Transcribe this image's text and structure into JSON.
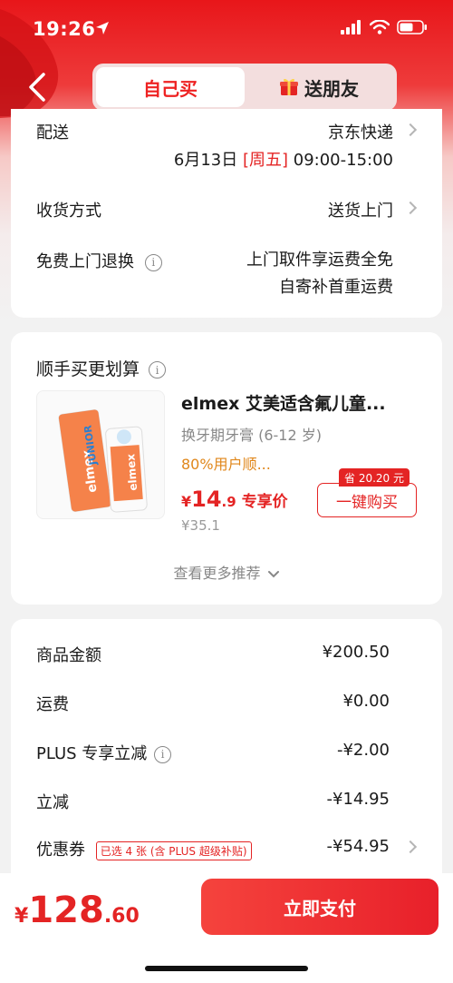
{
  "status_bar": {
    "time": "19:26"
  },
  "nav": {
    "tab_self": "自己买",
    "tab_gift": "送朋友"
  },
  "delivery": {
    "shipping_label": "配送",
    "shipping_value": "京东快递",
    "date": "6月13日",
    "weekday": "[周五]",
    "time_range": "09:00-15:00",
    "receive_label": "收货方式",
    "receive_value": "送货上门",
    "return_label": "免费上门退换",
    "return_line1": "上门取件享运费全免",
    "return_line2": "自寄补首重运费"
  },
  "recommend": {
    "title": "顺手买更划算",
    "product_title": "elmex 艾美适含氟儿童...",
    "product_sub": "换牙期牙膏 (6-12 岁)",
    "product_tag": "80%用户顺...",
    "price_currency": "¥",
    "price_int": "14",
    "price_dec": ".9",
    "price_label": "专享价",
    "original_price": "¥35.1",
    "save_badge": "省 20.20 元",
    "buy_button": "一键购买",
    "more_link": "查看更多推荐"
  },
  "summary": {
    "rows": [
      {
        "label": "商品金额",
        "value": "¥200.50",
        "red": false
      },
      {
        "label": "运费",
        "value": "¥0.00",
        "red": false
      },
      {
        "label": "PLUS 专享立减",
        "value": "-¥2.00",
        "red": true
      },
      {
        "label": "立减",
        "value": "-¥14.95",
        "red": true
      },
      {
        "label": "优惠券",
        "value": "-¥54.95",
        "red": true
      }
    ],
    "coupon_tag": "已选 4 张 (含 PLUS 超级补贴)"
  },
  "bottom": {
    "currency": "¥",
    "total_int": "128",
    "total_dec": ".60",
    "pay_button": "立即支付"
  },
  "colors": {
    "brand_red": "#e42424",
    "tag_orange": "#e0871b"
  },
  "icons": [
    "location-arrow-icon",
    "signal-icon",
    "wifi-icon",
    "battery-icon",
    "back-icon",
    "gift-icon",
    "info-icon",
    "chevron-right-icon",
    "chevron-down-icon"
  ]
}
